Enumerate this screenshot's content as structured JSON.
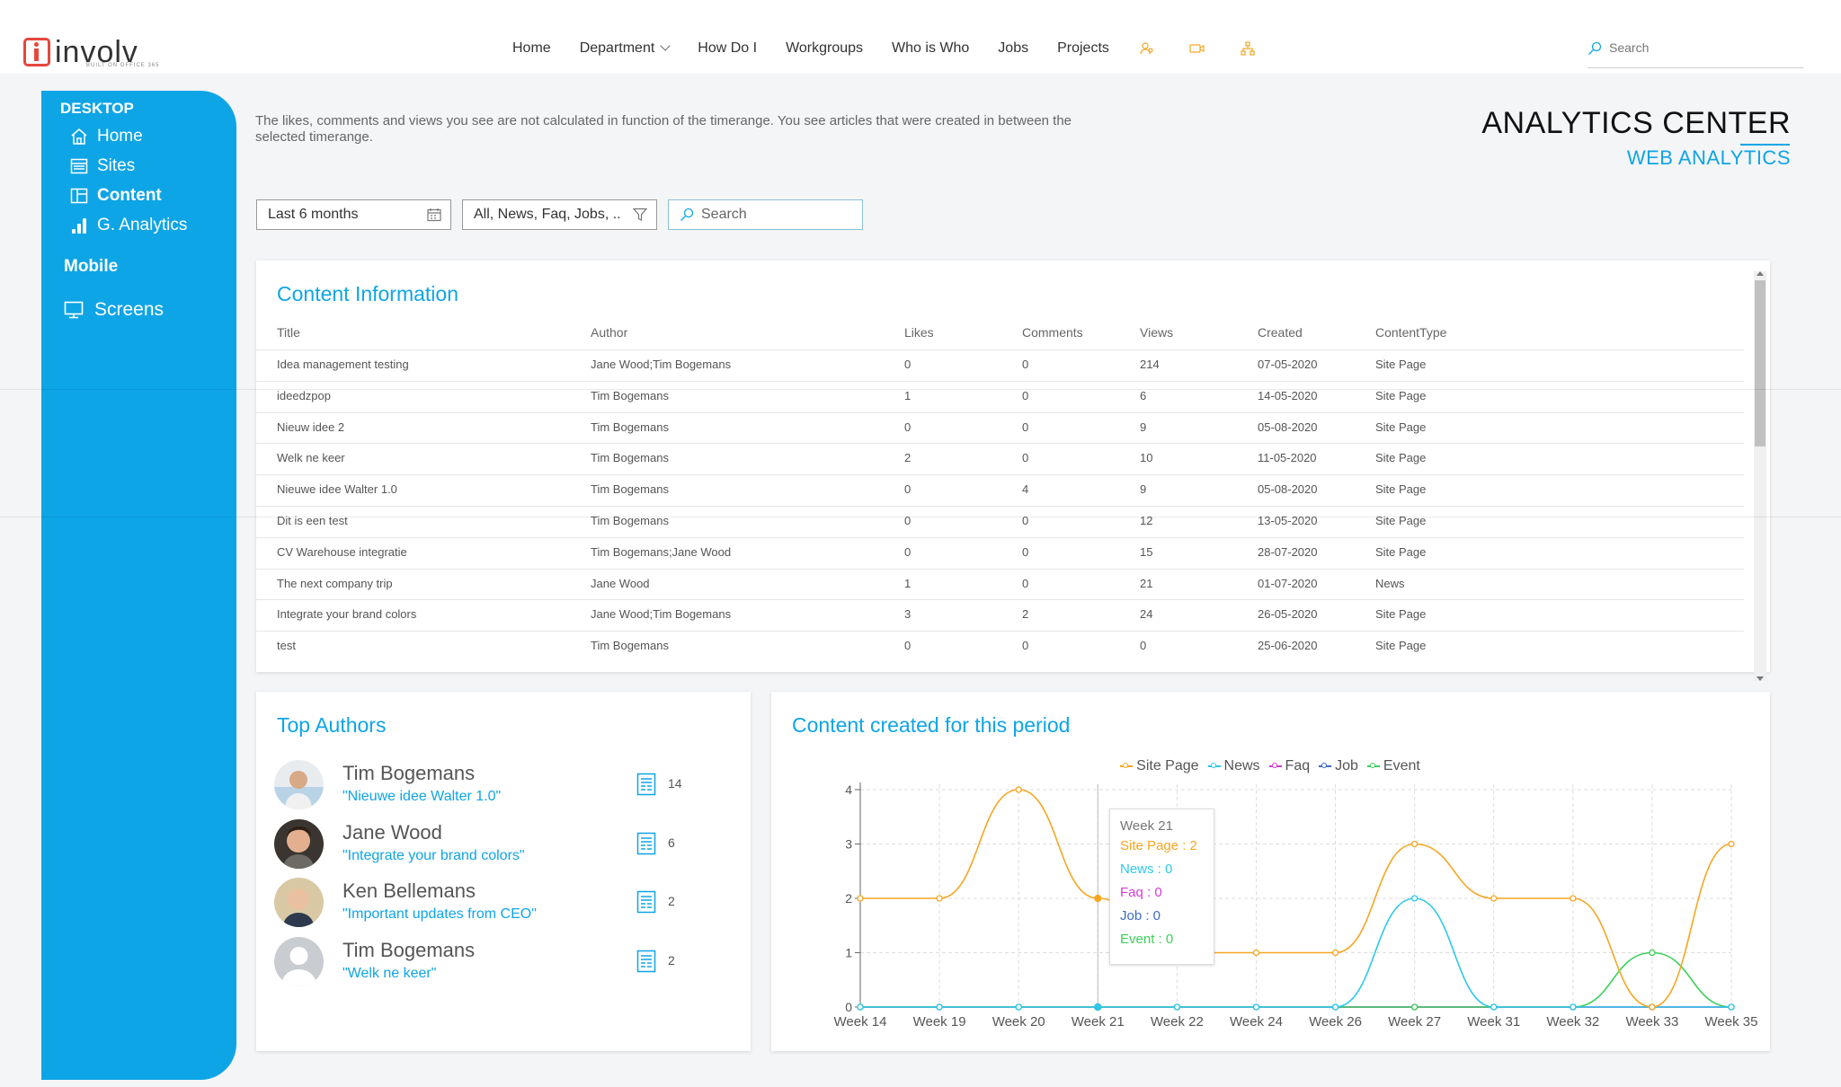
{
  "app": {
    "logo_text": "involv",
    "logo_sub": "BUILT ON OFFICE 365"
  },
  "nav": {
    "items": [
      "Home",
      "Department",
      "How Do I",
      "Workgroups",
      "Who is Who",
      "Jobs",
      "Projects"
    ],
    "icons": [
      "people-icon",
      "video-icon",
      "sitemap-icon"
    ],
    "search_placeholder": "Search",
    "accent_color": "#f5a623"
  },
  "sidebar": {
    "heading": "DESKTOP",
    "items": [
      {
        "label": "Home",
        "icon": "home-icon"
      },
      {
        "label": "Sites",
        "icon": "browser-icon"
      },
      {
        "label": "Content",
        "icon": "layout-icon"
      },
      {
        "label": "G. Analytics",
        "icon": "bar-chart-icon"
      }
    ],
    "mobile_label": "Mobile",
    "screens_label": "Screens",
    "color": "#0ea5e6"
  },
  "header": {
    "notice": "The likes, comments and views you see are not calculated in function of the timerange. You see articles that were created in between the selected timerange.",
    "title": "ANALYTICS CENTER",
    "subtitle": "WEB ANALYTICS"
  },
  "filters": {
    "timerange": "Last 6 months",
    "types": "All, News, Faq, Jobs, ..",
    "search_placeholder": "Search"
  },
  "content_info": {
    "title": "Content Information",
    "columns": [
      "Title",
      "Author",
      "Likes",
      "Comments",
      "Views",
      "Created",
      "ContentType"
    ],
    "rows": [
      [
        "Idea management testing",
        "Jane Wood;Tim Bogemans",
        "0",
        "0",
        "214",
        "07-05-2020",
        "Site Page"
      ],
      [
        "ideedzpop",
        "Tim Bogemans",
        "1",
        "0",
        "6",
        "14-05-2020",
        "Site Page"
      ],
      [
        "Nieuw idee 2",
        "Tim Bogemans",
        "0",
        "0",
        "9",
        "05-08-2020",
        "Site Page"
      ],
      [
        "Welk ne keer",
        "Tim Bogemans",
        "2",
        "0",
        "10",
        "11-05-2020",
        "Site Page"
      ],
      [
        "Nieuwe idee Walter 1.0",
        "Tim Bogemans",
        "0",
        "4",
        "9",
        "05-08-2020",
        "Site Page"
      ],
      [
        "Dit is een test",
        "Tim Bogemans",
        "0",
        "0",
        "12",
        "13-05-2020",
        "Site Page"
      ],
      [
        "CV Warehouse integratie",
        "Tim Bogemans;Jane Wood",
        "0",
        "0",
        "15",
        "28-07-2020",
        "Site Page"
      ],
      [
        "The next company trip",
        "Jane Wood",
        "1",
        "0",
        "21",
        "01-07-2020",
        "News"
      ],
      [
        "Integrate your brand colors",
        "Jane Wood;Tim Bogemans",
        "3",
        "2",
        "24",
        "26-05-2020",
        "Site Page"
      ],
      [
        "test",
        "Tim Bogemans",
        "0",
        "0",
        "0",
        "25-06-2020",
        "Site Page"
      ]
    ]
  },
  "top_authors": {
    "title": "Top Authors",
    "authors": [
      {
        "name": "Tim Bogemans",
        "quote": "\"Nieuwe idee Walter 1.0\"",
        "count": "14"
      },
      {
        "name": "Jane Wood",
        "quote": "\"Integrate your brand colors\"",
        "count": "6"
      },
      {
        "name": "Ken Bellemans",
        "quote": "\"Important updates from CEO\"",
        "count": "2"
      },
      {
        "name": "Tim Bogemans",
        "quote": "\"Welk ne keer\"",
        "count": "2"
      }
    ]
  },
  "chart_data": {
    "type": "line",
    "title": "Content created for this period",
    "categories": [
      "Week 14",
      "Week 19",
      "Week 20",
      "Week 21",
      "Week 22",
      "Week 24",
      "Week 26",
      "Week 27",
      "Week 31",
      "Week 32",
      "Week 33",
      "Week 35"
    ],
    "series": [
      {
        "name": "Site Page",
        "color": "#f5a623",
        "values": [
          2,
          2,
          4,
          2,
          1,
          1,
          1,
          3,
          2,
          2,
          0,
          3
        ]
      },
      {
        "name": "News",
        "color": "#2dc9e8",
        "values": [
          0,
          0,
          0,
          0,
          0,
          0,
          0,
          2,
          0,
          0,
          0,
          0
        ]
      },
      {
        "name": "Faq",
        "color": "#d63bd0",
        "values": [
          0,
          0,
          0,
          0,
          0,
          0,
          0,
          0,
          0,
          0,
          0,
          0
        ]
      },
      {
        "name": "Job",
        "color": "#3c6bc9",
        "values": [
          0,
          0,
          0,
          0,
          0,
          0,
          0,
          0,
          0,
          0,
          0,
          0
        ]
      },
      {
        "name": "Event",
        "color": "#3ccf5a",
        "values": [
          0,
          0,
          0,
          0,
          0,
          0,
          0,
          0,
          0,
          0,
          1,
          0
        ]
      }
    ],
    "ylim": [
      0,
      4
    ],
    "yticks": [
      "0",
      "1",
      "2",
      "3",
      "4"
    ],
    "grid": true,
    "legend": "top-center",
    "tooltip": {
      "header": "Week 21",
      "lines": [
        "Site Page : 2",
        "News : 0",
        "Faq : 0",
        "Job : 0",
        "Event : 0"
      ]
    }
  }
}
